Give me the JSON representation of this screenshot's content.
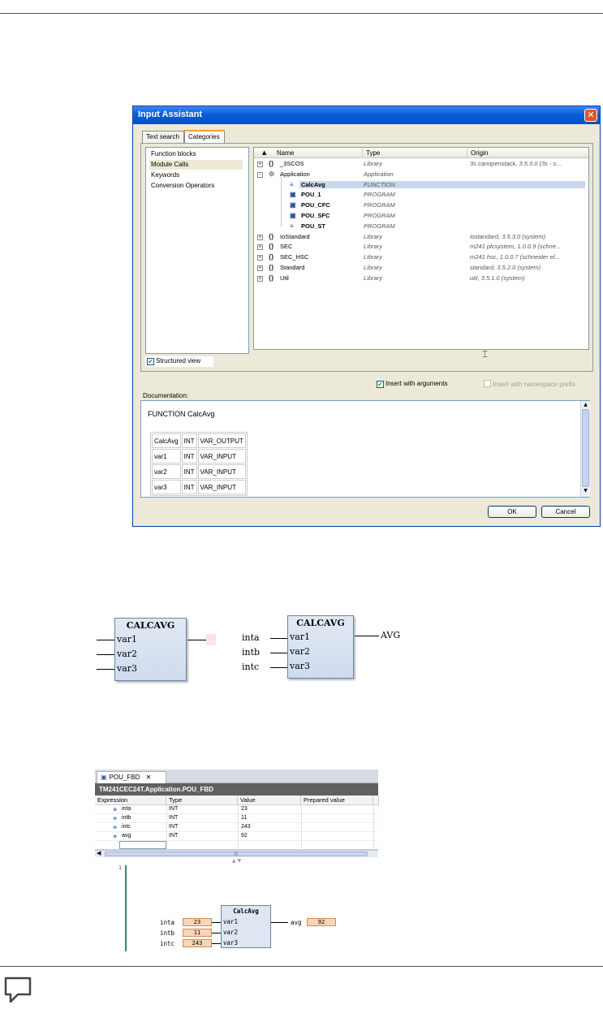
{
  "dialog": {
    "title": "Input Assistant",
    "tabs": [
      "Text search",
      "Categories"
    ],
    "categories": [
      "Function blocks",
      "Module Calls",
      "Keywords",
      "Conversion Operators"
    ],
    "structured_view": "Structured view",
    "columns": [
      "Name",
      "Type",
      "Origin"
    ],
    "tree": [
      {
        "name": "_3SCOS",
        "type": "Library",
        "origin": "3s canopenstack, 3.5.3.0 (3s - s..."
      },
      {
        "name": "Application",
        "type": "Application",
        "origin": ""
      },
      {
        "name": "CalcAvg",
        "type": "FUNCTION",
        "origin": ""
      },
      {
        "name": "POU_1",
        "type": "PROGRAM",
        "origin": ""
      },
      {
        "name": "POU_CFC",
        "type": "PROGRAM",
        "origin": ""
      },
      {
        "name": "POU_SFC",
        "type": "PROGRAM",
        "origin": ""
      },
      {
        "name": "POU_ST",
        "type": "PROGRAM",
        "origin": ""
      },
      {
        "name": "IoStandard",
        "type": "Library",
        "origin": "iostandard, 3.5.3.0 (system)"
      },
      {
        "name": "SEC",
        "type": "Library",
        "origin": "m241 plcsystem, 1.0.0.9 (schne..."
      },
      {
        "name": "SEC_HSC",
        "type": "Library",
        "origin": "m241 hsc, 1.0.0.7 (schneider el..."
      },
      {
        "name": "Standard",
        "type": "Library",
        "origin": "standard, 3.5.2.0 (system)"
      },
      {
        "name": "Util",
        "type": "Library",
        "origin": "util, 3.5.1.0 (system)"
      }
    ],
    "insert_with_arguments": "Insert with arguments",
    "insert_with_namespace": "Insert with namespace prefix",
    "documentation_label": "Documentation:",
    "documentation_heading": "FUNCTION CalcAvg",
    "doc_table": [
      [
        "CalcAvg",
        "INT",
        "VAR_OUTPUT"
      ],
      [
        "var1",
        "INT",
        "VAR_INPUT"
      ],
      [
        "var2",
        "INT",
        "VAR_INPUT"
      ],
      [
        "var3",
        "INT",
        "VAR_INPUT"
      ]
    ],
    "ok": "OK",
    "cancel": "Cancel"
  },
  "fbd_empty": {
    "title": "CALCAVG",
    "pins": [
      "var1",
      "var2",
      "var3"
    ]
  },
  "fbd_full": {
    "title": "CALCAVG",
    "pins": [
      "var1",
      "var2",
      "var3"
    ],
    "inputs": [
      "inta",
      "intb",
      "intc"
    ],
    "output": "AVG"
  },
  "watch": {
    "tab": "POU_FBD",
    "path": "TM241CEC24T.Application.POU_FBD",
    "columns": [
      "Expression",
      "Type",
      "Value",
      "Prepared value"
    ],
    "rows": [
      {
        "expr": "inta",
        "type": "INT",
        "value": "23"
      },
      {
        "expr": "intb",
        "type": "INT",
        "value": "11"
      },
      {
        "expr": "intc",
        "type": "INT",
        "value": "243"
      },
      {
        "expr": "avg",
        "type": "INT",
        "value": "92"
      }
    ],
    "line": "1",
    "block_title": "CalcAvg",
    "pins": [
      "var1",
      "var2",
      "var3"
    ],
    "inputs": [
      {
        "name": "inta",
        "value": "23"
      },
      {
        "name": "intb",
        "value": "11"
      },
      {
        "name": "intc",
        "value": "243"
      }
    ],
    "output": {
      "name": "avg",
      "value": "92"
    }
  }
}
